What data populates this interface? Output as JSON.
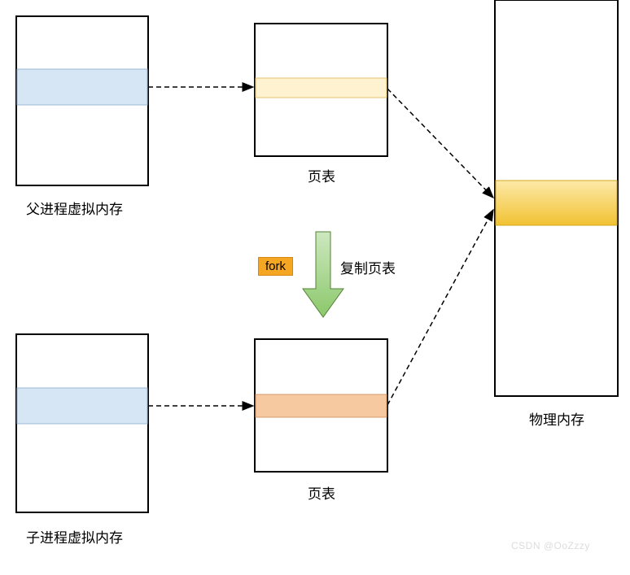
{
  "labels": {
    "parent_vm": "父进程虚拟内存",
    "child_vm": "子进程虚拟内存",
    "page_table_top": "页表",
    "page_table_bottom": "页表",
    "physical_mem": "物理内存",
    "copy_pt": "复制页表",
    "fork": "fork"
  },
  "watermark": "CSDN @OoZzzy",
  "colors": {
    "box_stroke": "#000000",
    "blue_fill": "#d6e6f5",
    "blue_stroke": "#9cb8d6",
    "yellow_fill_light": "#fff2d1",
    "yellow_stroke": "#e8c06a",
    "orange_fill": "#f7c9a0",
    "orange_stroke": "#d49a6a",
    "gold_grad_top": "#fde9a8",
    "gold_grad_bot": "#f1c232",
    "gold_stroke": "#d4a71e",
    "arrow_green_top": "#a8d08d",
    "arrow_green_bot": "#70ad47",
    "arrow_green_stroke": "#548235"
  },
  "chart_data": {
    "type": "diagram",
    "nodes": [
      {
        "id": "parent_vm",
        "label": "父进程虚拟内存",
        "highlight": "blue"
      },
      {
        "id": "child_vm",
        "label": "子进程虚拟内存",
        "highlight": "blue"
      },
      {
        "id": "pt_top",
        "label": "页表",
        "highlight": "light_yellow"
      },
      {
        "id": "pt_bottom",
        "label": "页表",
        "highlight": "orange"
      },
      {
        "id": "phys_mem",
        "label": "物理内存",
        "highlight": "gold"
      }
    ],
    "edges": [
      {
        "from": "parent_vm",
        "to": "pt_top",
        "style": "dashed"
      },
      {
        "from": "child_vm",
        "to": "pt_bottom",
        "style": "dashed"
      },
      {
        "from": "pt_top",
        "to": "phys_mem",
        "style": "dashed"
      },
      {
        "from": "pt_bottom",
        "to": "phys_mem",
        "style": "dashed"
      },
      {
        "from": "pt_top",
        "to": "pt_bottom",
        "style": "fork_arrow",
        "label": "复制页表",
        "tag": "fork"
      }
    ]
  }
}
